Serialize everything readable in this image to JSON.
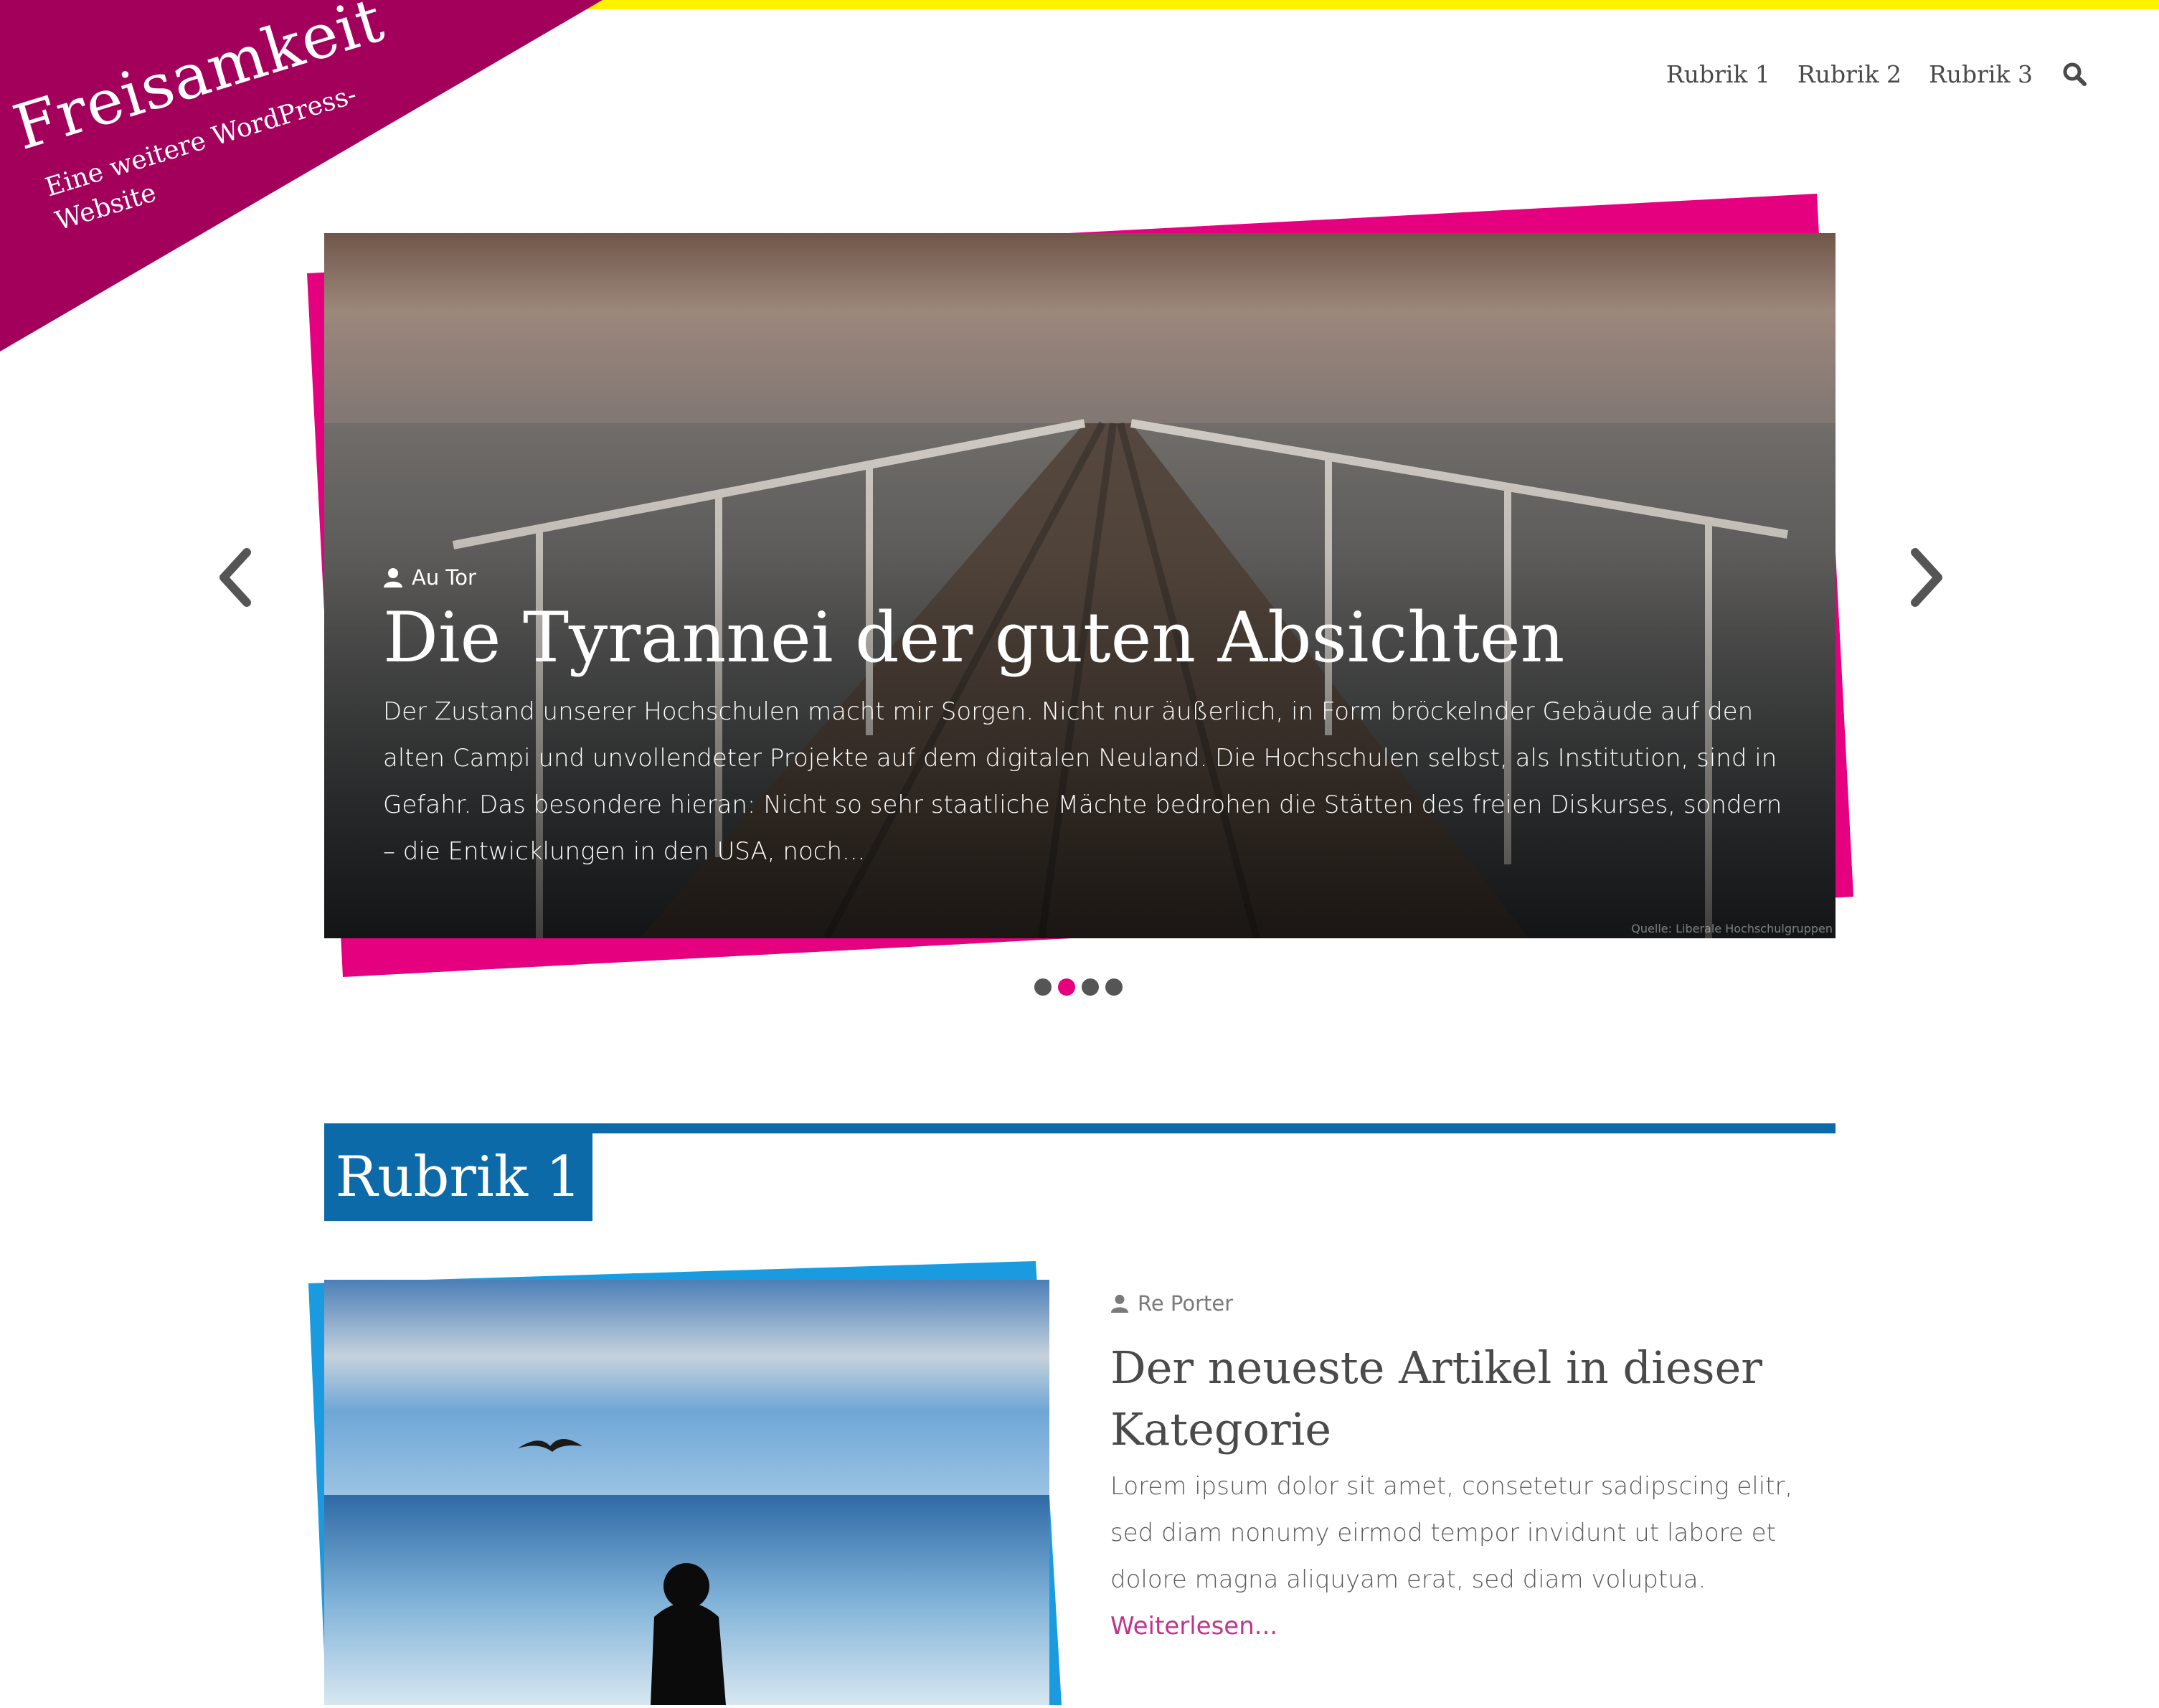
{
  "site": {
    "title": "Freisamkeit",
    "tagline": "Eine weitere WordPress-Website",
    "colors": {
      "topbar": "#fff200",
      "logo_bg": "#a3005c",
      "accent_pink": "#e4007f",
      "accent_blue": "#0d6aa8",
      "link": "#c0348e"
    }
  },
  "nav": {
    "items": [
      "Rubrik 1",
      "Rubrik 2",
      "Rubrik 3"
    ],
    "search_icon": "search-icon"
  },
  "hero": {
    "author": "Au Tor",
    "title": "Die Tyrannei der guten Absichten",
    "excerpt": "Der Zustand unserer Hochschulen macht mir Sorgen. Nicht nur äußerlich, in Form bröckelnder Gebäude auf den alten Campi und unvollendeter Projekte auf dem digitalen Neuland. Die Hochschulen selbst, als Institution, sind in Gefahr. Das besondere hieran: Nicht so sehr staatliche Mächte bedrohen die Stätten des freien Diskurses, sondern – die Entwicklungen in den USA, noch...",
    "image_credit": "Quelle: Liberale Hochschulgruppen",
    "prev_icon": "chevron-left-icon",
    "next_icon": "chevron-right-icon",
    "slide_count": 4,
    "active_slide": 2
  },
  "section": {
    "title": "Rubrik 1",
    "article": {
      "author": "Re Porter",
      "title": "Der neueste Artikel in dieser Kategorie",
      "excerpt": "Lorem ipsum dolor sit amet, consetetur sadipscing elitr, sed diam nonumy eirmod tempor invidunt ut labore et dolore magna aliquyam erat, sed diam voluptua.",
      "read_more": "Weiterlesen..."
    }
  }
}
